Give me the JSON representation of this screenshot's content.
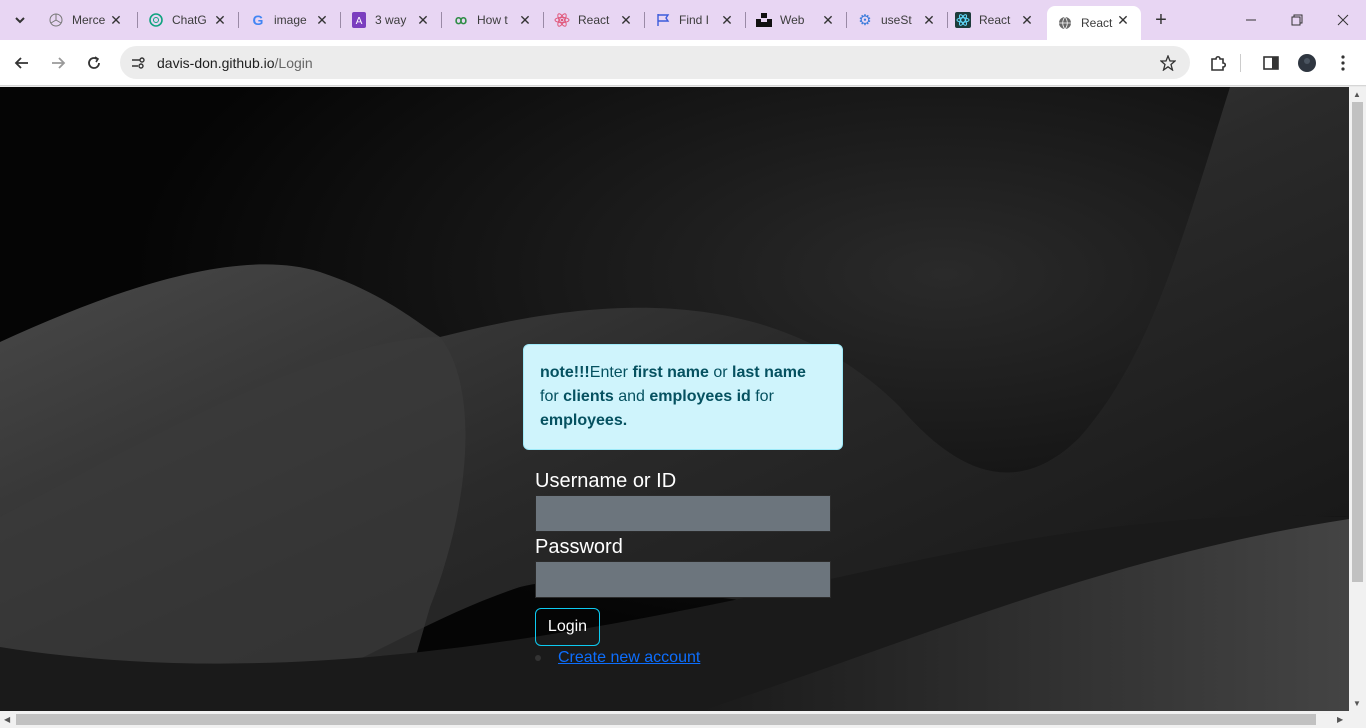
{
  "browser": {
    "tabs": [
      {
        "title": "Merce",
        "icon": "mercedes-icon",
        "color": "#777777"
      },
      {
        "title": "ChatG",
        "icon": "chatgpt-icon",
        "color": "#10a37f"
      },
      {
        "title": "image",
        "icon": "google-icon",
        "color": "#4285f4"
      },
      {
        "title": "3 way",
        "icon": "purple-a-icon",
        "color": "#7b3fbf"
      },
      {
        "title": "How t",
        "icon": "gfg-icon",
        "color": "#2f8d46"
      },
      {
        "title": "React",
        "icon": "react-icon",
        "color": "#e0567a"
      },
      {
        "title": "Find I",
        "icon": "flag-icon",
        "color": "#3b5bdb"
      },
      {
        "title": "Web",
        "icon": "unsplash-icon",
        "color": "#111111"
      },
      {
        "title": "useSt",
        "icon": "gear-icon",
        "color": "#3b7bdb"
      },
      {
        "title": "React",
        "icon": "react-dark-icon",
        "color": "#1d3b3b"
      },
      {
        "title": "React",
        "icon": "globe-icon",
        "color": "#666666",
        "active": true
      }
    ],
    "url_host": "davis-don.github.io",
    "url_path": "/Login"
  },
  "page": {
    "note": {
      "prefix": "note!!!",
      "t1": "Enter ",
      "b1": "first name",
      "t2": " or ",
      "b2": "last name",
      "t3": " for ",
      "b3": "clients",
      "t4": " and ",
      "b4": "employees id",
      "t5": " for ",
      "b5": "employees."
    },
    "username_label": "Username or ID",
    "username_value": "",
    "password_label": "Password",
    "password_value": "",
    "login_button": "Login",
    "create_account_link": "Create new account"
  },
  "colors": {
    "note_bg": "#cff4fc",
    "note_text": "#055160",
    "button_border": "#0dcaf0",
    "link": "#0d6efd",
    "input_bg": "#6c757d"
  }
}
